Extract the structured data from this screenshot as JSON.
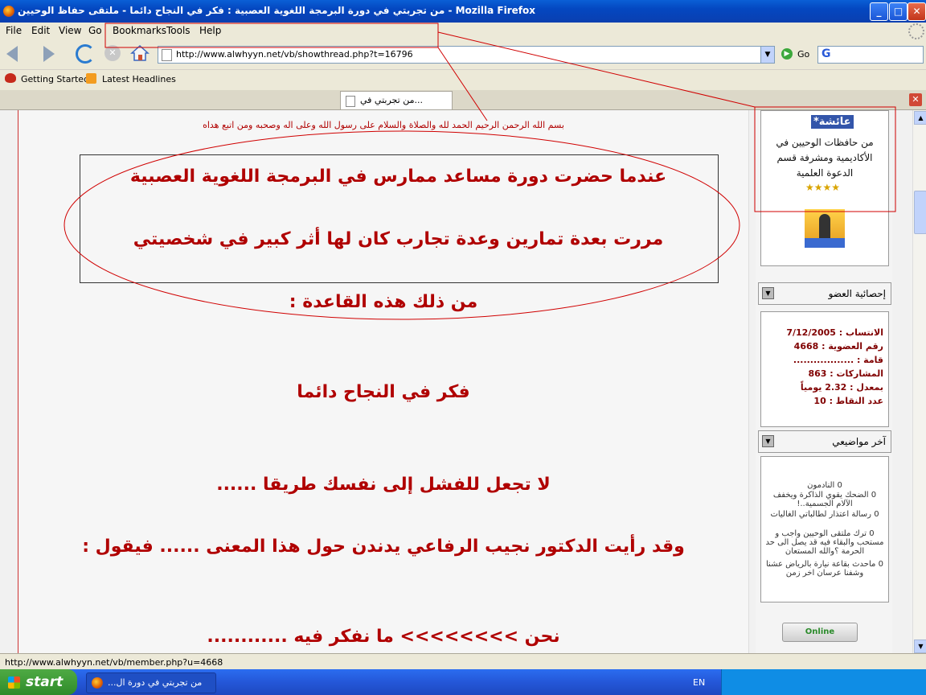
{
  "window": {
    "title": "من تجربتي في دورة البرمجة اللغوية العصبية : فكر في النجاح دائما - ملتقى حفاظ الوحيين - Mozilla Firefox",
    "minimize": "_",
    "maximize": "□",
    "close": "✕"
  },
  "menu": {
    "items": [
      "File",
      "Edit",
      "View",
      "Go",
      "Bookmarks",
      "Tools",
      "Help"
    ]
  },
  "toolbar": {
    "url": "http://www.alwhyyn.net/vb/showthread.php?t=16796",
    "go_label": "Go",
    "search_engine": "G"
  },
  "bookmarks": {
    "items": [
      "Getting Started",
      "Latest Headlines"
    ]
  },
  "tab": {
    "label": "...من تجربتي في"
  },
  "post": {
    "basmala": "بسم الله الرحمن الرحيم الحمد لله والصلاة والسلام على رسول الله وعلى اله وصحبه ومن اتبع هداه",
    "line1": "عندما حضرت دورة مساعد ممارس في البرمجة اللغوية العصبية",
    "line2": "مررت بعدة تمارين وعدة تجارب كان لها أثر كبير في شخصيتي",
    "line3": "من ذلك هذه القاعدة :",
    "line4": "فكر في النجاح دائما",
    "line5": "لا تجعل للفشل إلى نفسك طريقا ......",
    "line6": "وقد رأيت الدكتور نجيب الرفاعي يدندن حول هذا المعنى ...... فيقول :",
    "line7": "نحن >>>>>>>> ما نفكر فيه ............"
  },
  "member": {
    "name": "عائشة*",
    "title": "من حافظات الوحيين في الأكاديمية ومشرفة قسم الدعوة العلمية",
    "stars": "★★★★",
    "stats_header": "إحصائية العضو",
    "stats": [
      "الانتساب : 7/12/2005",
      "رقم العضوية : 4668",
      "قامة : ..................",
      "المشاركات : 863",
      "بمعدل : 2.32 يومياً",
      "عدد النقاط : 10"
    ],
    "topics_header": "آخر مواضيعي",
    "topics": [
      "0 النادمون",
      "0 الضحك يقوي الذاكرة ويخفف الآلام الجسمية..!",
      "0 رسالة اعتذار لطالباتي الغاليات",
      "0 ترك ملتقى الوحيين واجب و مستحب والبقاء فيه قد يصل الى حد الحرمة ؟والله المستعان",
      "0 ماحدث بقاعة نيارة بالرياض عشنا وشفنا عرسان اخر زمن"
    ],
    "online_label": "Online"
  },
  "status": {
    "text": "http://www.alwhyyn.net/vb/member.php?u=4668"
  },
  "taskbar": {
    "start_label": "start",
    "task_label": "من تجربتي في دورة ال...",
    "lang": "EN"
  },
  "colors": {
    "post_text": "#b00000",
    "annotation": "#d00000",
    "xp_blue": "#0a5fd6"
  }
}
